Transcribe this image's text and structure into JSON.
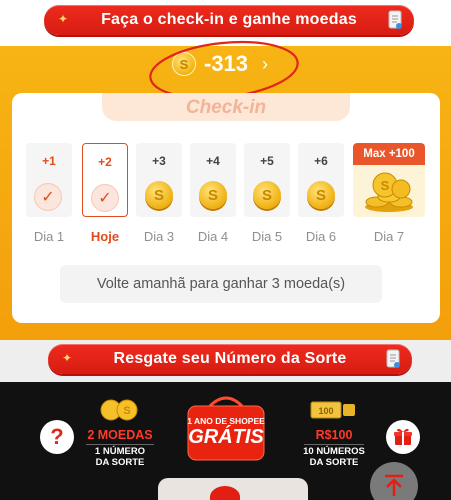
{
  "header": {
    "banner_title": "Faça o check-in e ganhe moedas"
  },
  "balance": {
    "value": "-313",
    "chevron": "›"
  },
  "checkin": {
    "title": "Check-in",
    "days": [
      {
        "bonus": "+1",
        "label": "Dia 1",
        "state": "checked"
      },
      {
        "bonus": "+2",
        "label": "Hoje",
        "state": "today-checked"
      },
      {
        "bonus": "+3",
        "label": "Dia 3",
        "state": "coin"
      },
      {
        "bonus": "+4",
        "label": "Dia 4",
        "state": "coins"
      },
      {
        "bonus": "+5",
        "label": "Dia 5",
        "state": "coins"
      },
      {
        "bonus": "+6",
        "label": "Dia 6",
        "state": "coin"
      }
    ],
    "day7": {
      "bonus": "Max +100",
      "label": "Dia 7"
    },
    "notice": "Volte amanhã para ganhar 3 moeda(s)"
  },
  "lucky": {
    "banner_title": "Resgate seu Número da Sorte"
  },
  "promo": {
    "help_symbol": "?",
    "left": {
      "title": "2 MOEDAS",
      "line1": "1 NÚMERO",
      "line2": "DA SORTE",
      "coin_symbol": "S"
    },
    "center": {
      "top": "1 ANO DE SHOPEE",
      "main": "GRÁTIS"
    },
    "right": {
      "title": "R$100",
      "line1": "10 NÚMEROS",
      "line2": "DA SORTE",
      "voucher_text": "100"
    }
  },
  "colors": {
    "accent_red": "#e21f12",
    "orange": "#f5aa10",
    "coin_gold": "#f0b011",
    "dark_bg": "#111111"
  },
  "icons": {
    "sparkle": "sparkle-icon",
    "scroll": "scroll-icon",
    "coin": "coin-icon",
    "check": "check-icon",
    "help": "help-icon",
    "gift": "gift-icon",
    "back_to_top": "back-to-top-icon"
  }
}
